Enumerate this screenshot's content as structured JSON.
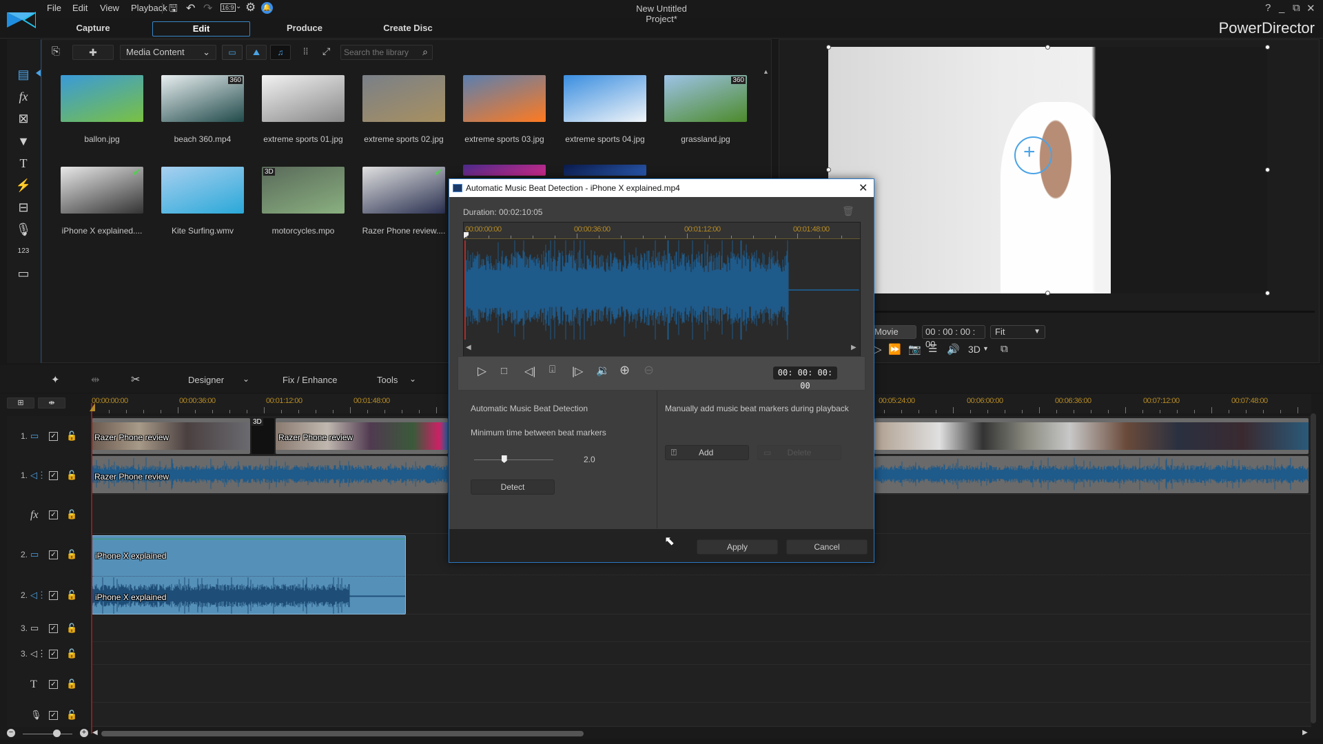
{
  "app": {
    "name": "PowerDirector",
    "project_title": "New Untitled Project*",
    "menu": [
      "File",
      "Edit",
      "View",
      "Playback"
    ],
    "toolbar_icons": [
      "save-icon",
      "undo-icon",
      "redo-icon",
      "aspect-ratio-icon",
      "settings-icon",
      "notification-icon"
    ],
    "aspect_ratio": "16:9",
    "window_controls": {
      "help": "?",
      "minimize": "_",
      "restore": "⧉",
      "close": "✕"
    }
  },
  "main_tabs": [
    {
      "label": "Capture",
      "active": false
    },
    {
      "label": "Edit",
      "active": true
    },
    {
      "label": "Produce",
      "active": false
    },
    {
      "label": "Create Disc",
      "active": false
    }
  ],
  "left_rail": [
    "media-room-icon",
    "fx-icon",
    "pip-designer-icon",
    "particle-icon",
    "title-icon",
    "transition-icon",
    "audio-mixing-icon",
    "voiceover-icon",
    "chapter-icon",
    "subtitle-icon"
  ],
  "library": {
    "content_dropdown": "Media Content",
    "search_placeholder": "Search the library",
    "items": [
      {
        "label": "ballon.jpg",
        "badge": "",
        "check": false,
        "colors": [
          "#3a9ad9",
          "#7ac142"
        ]
      },
      {
        "label": "beach 360.mp4",
        "badge": "360",
        "check": false,
        "colors": [
          "#e8eef0",
          "#214a4a"
        ]
      },
      {
        "label": "extreme sports 01.jpg",
        "badge": "",
        "check": false,
        "colors": [
          "#f2f2f2",
          "#888"
        ]
      },
      {
        "label": "extreme sports 02.jpg",
        "badge": "",
        "check": false,
        "colors": [
          "#7a8088",
          "#a89060"
        ]
      },
      {
        "label": "extreme sports 03.jpg",
        "badge": "",
        "check": false,
        "colors": [
          "#5a7fb0",
          "#ff7a20"
        ]
      },
      {
        "label": "extreme sports 04.jpg",
        "badge": "",
        "check": false,
        "colors": [
          "#3a8ee0",
          "#f0f4f8"
        ]
      },
      {
        "label": "grassland.jpg",
        "badge": "360",
        "check": false,
        "colors": [
          "#9ec3e8",
          "#4c8a2a"
        ]
      },
      {
        "label": "iPhone X explained....",
        "badge": "",
        "check": true,
        "colors": [
          "#e8e8e8",
          "#333"
        ]
      },
      {
        "label": "Kite Surfing.wmv",
        "badge": "",
        "check": false,
        "colors": [
          "#a8d0f0",
          "#2aa8d8"
        ]
      },
      {
        "label": "motorcycles.mpo",
        "badge": "3D",
        "badge_left": true,
        "check": false,
        "colors": [
          "#5a6a5a",
          "#8ab080"
        ]
      },
      {
        "label": "Razer Phone review....",
        "badge": "",
        "check": true,
        "colors": [
          "#e0e0e0",
          "#2a3050"
        ]
      },
      {
        "label": "",
        "badge": "",
        "check": false,
        "colors": [
          "#4a2a8a",
          "#d02a8a"
        ]
      },
      {
        "label": "",
        "badge": "",
        "check": false,
        "colors": [
          "#0a1a4a",
          "#2a5ab0"
        ]
      }
    ]
  },
  "preview": {
    "mode": "Movie",
    "timecode": "00 : 00 : 00 : 00",
    "zoom": "Fit",
    "threed_label": "3D"
  },
  "edit_toolbar": {
    "designer": "Designer",
    "fix_enhance": "Fix / Enhance",
    "tools": "Tools"
  },
  "timeline": {
    "ruler_ticks": [
      "00:00:00:00",
      "00:00:36:00",
      "00:01:12:00",
      "00:01:48:00",
      "00:05:24:00",
      "00:06:00:00",
      "00:06:36:00",
      "00:07:12:00",
      "00:07:48:00"
    ],
    "tracks": [
      {
        "num": "1.",
        "type": "video",
        "icon": "video-track-icon"
      },
      {
        "num": "1.",
        "type": "audio",
        "icon": "audio-track-icon"
      },
      {
        "num": "",
        "type": "fx",
        "icon": "fx-track-icon"
      },
      {
        "num": "2.",
        "type": "video",
        "icon": "video-track-icon"
      },
      {
        "num": "2.",
        "type": "audio",
        "icon": "audio-track-icon"
      },
      {
        "num": "3.",
        "type": "video",
        "icon": "video-track-icon"
      },
      {
        "num": "3.",
        "type": "audio",
        "icon": "audio-track-icon"
      },
      {
        "num": "",
        "type": "title",
        "icon": "title-track-icon"
      },
      {
        "num": "",
        "type": "voice",
        "icon": "microphone-icon"
      }
    ],
    "clips": {
      "track1_video_a": "Razer Phone review",
      "track1_video_b": "Razer Phone review",
      "track1_audio": "Razer Phone review",
      "track2_video": "iPhone X explained",
      "track2_audio": "iPhone X explained",
      "transition_badge": "3D"
    }
  },
  "dialog": {
    "title": "Automatic Music Beat Detection - iPhone X explained.mp4",
    "duration": "Duration: 00:02:10:05",
    "ruler_ticks": [
      "00:00:00:00",
      "00:00:36:00",
      "00:01:12:00",
      "00:01:48:00"
    ],
    "timecode": "00: 00: 00: 00",
    "auto_section_title": "Automatic Music Beat Detection",
    "min_time_label": "Minimum time between beat markers",
    "min_time_value": "2.0",
    "min_time_slider_fraction": 0.38,
    "detect_button": "Detect",
    "manual_section_title": "Manually add music beat markers during playback",
    "add_button": "Add",
    "delete_button": "Delete",
    "apply_button": "Apply",
    "cancel_button": "Cancel"
  }
}
